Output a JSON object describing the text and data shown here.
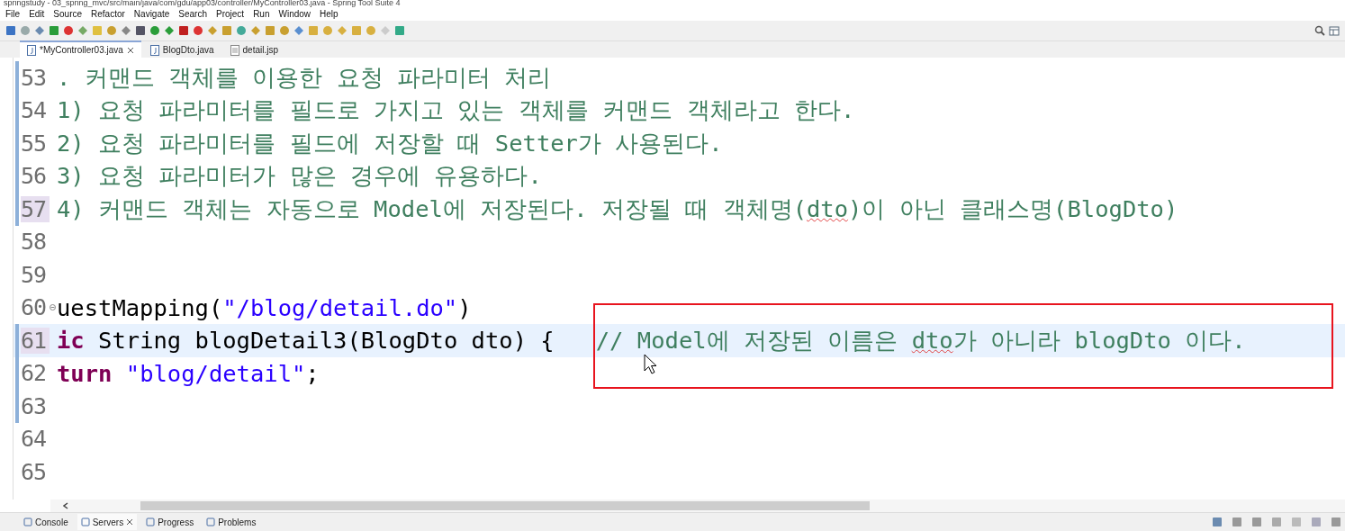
{
  "window": {
    "title": "springstudy - 03_spring_mvc/src/main/java/com/gdu/app03/controller/MyController03.java - Spring Tool Suite 4"
  },
  "menu": [
    "File",
    "Edit",
    "Source",
    "Refactor",
    "Navigate",
    "Search",
    "Project",
    "Run",
    "Window",
    "Help"
  ],
  "editor_tabs": [
    {
      "label": "*MyController03.java",
      "kind": "java",
      "selected": true
    },
    {
      "label": "BlogDto.java",
      "kind": "java",
      "selected": false
    },
    {
      "label": "detail.jsp",
      "kind": "jsp",
      "selected": false
    }
  ],
  "code_lines": [
    {
      "number": "53",
      "changed": true,
      "current": false,
      "marked": false,
      "fold": false,
      "segments": [
        {
          "kind": "comment",
          "text": ". 커맨드 객체를 이용한 요청 파라미터 처리"
        }
      ]
    },
    {
      "number": "54",
      "changed": true,
      "current": false,
      "marked": false,
      "fold": false,
      "segments": [
        {
          "kind": "comment",
          "text": "1) 요청 파라미터를 필드로 가지고 있는 객체를 커맨드 객체라고 한다."
        }
      ]
    },
    {
      "number": "55",
      "changed": true,
      "current": false,
      "marked": false,
      "fold": false,
      "segments": [
        {
          "kind": "comment",
          "text": "2) 요청 파라미터를 필드에 저장할 때 Setter가 사용된다."
        }
      ]
    },
    {
      "number": "56",
      "changed": true,
      "current": false,
      "marked": false,
      "fold": false,
      "segments": [
        {
          "kind": "comment",
          "text": "3) 요청 파라미터가 많은 경우에 유용하다."
        }
      ]
    },
    {
      "number": "57",
      "changed": true,
      "current": false,
      "marked": true,
      "fold": false,
      "segments": [
        {
          "kind": "comment",
          "text": "4) 커맨드 객체는 자동으로 Model에 저장된다. 저장될 때 객체명("
        },
        {
          "kind": "comment_misspelled",
          "text": "dto"
        },
        {
          "kind": "comment",
          "text": ")이 아닌 클래스명(BlogDto)"
        }
      ]
    },
    {
      "number": "58",
      "changed": false,
      "current": false,
      "marked": false,
      "fold": false
    },
    {
      "number": "59",
      "changed": false,
      "current": false,
      "marked": false,
      "fold": false
    },
    {
      "number": "60",
      "changed": false,
      "current": false,
      "marked": false,
      "fold": true,
      "segments": [
        {
          "kind": "plain",
          "text": "uestMapping("
        },
        {
          "kind": "string",
          "text": "\"/blog/detail.do\""
        },
        {
          "kind": "plain",
          "text": ")"
        }
      ]
    },
    {
      "number": "61",
      "changed": true,
      "current": true,
      "marked": true,
      "fold": false,
      "segments": [
        {
          "kind": "keyword",
          "text": "ic"
        },
        {
          "kind": "plain",
          "text": " String blogDetail3(BlogDto dto) {   "
        },
        {
          "kind": "comment",
          "text": "// Model에 저장된 이름은 "
        },
        {
          "kind": "comment_misspelled",
          "text": "dto"
        },
        {
          "kind": "comment",
          "text": "가 아니라 blogDto 이다."
        }
      ]
    },
    {
      "number": "62",
      "changed": true,
      "current": false,
      "marked": false,
      "fold": false,
      "segments": [
        {
          "kind": "keyword",
          "text": "turn"
        },
        {
          "kind": "string",
          "text": " \"blog/detail\""
        },
        {
          "kind": "plain",
          "text": ";"
        }
      ]
    },
    {
      "number": "63",
      "changed": true,
      "current": false,
      "marked": false,
      "fold": false
    },
    {
      "number": "64",
      "changed": false,
      "current": false,
      "marked": false,
      "fold": false
    },
    {
      "number": "65",
      "changed": false,
      "current": false,
      "marked": false,
      "fold": false
    }
  ],
  "bottom_tabs": [
    {
      "label": "Console",
      "selected": false
    },
    {
      "label": "Servers",
      "selected": true
    },
    {
      "label": "Progress",
      "selected": false
    },
    {
      "label": "Problems",
      "selected": false
    }
  ]
}
